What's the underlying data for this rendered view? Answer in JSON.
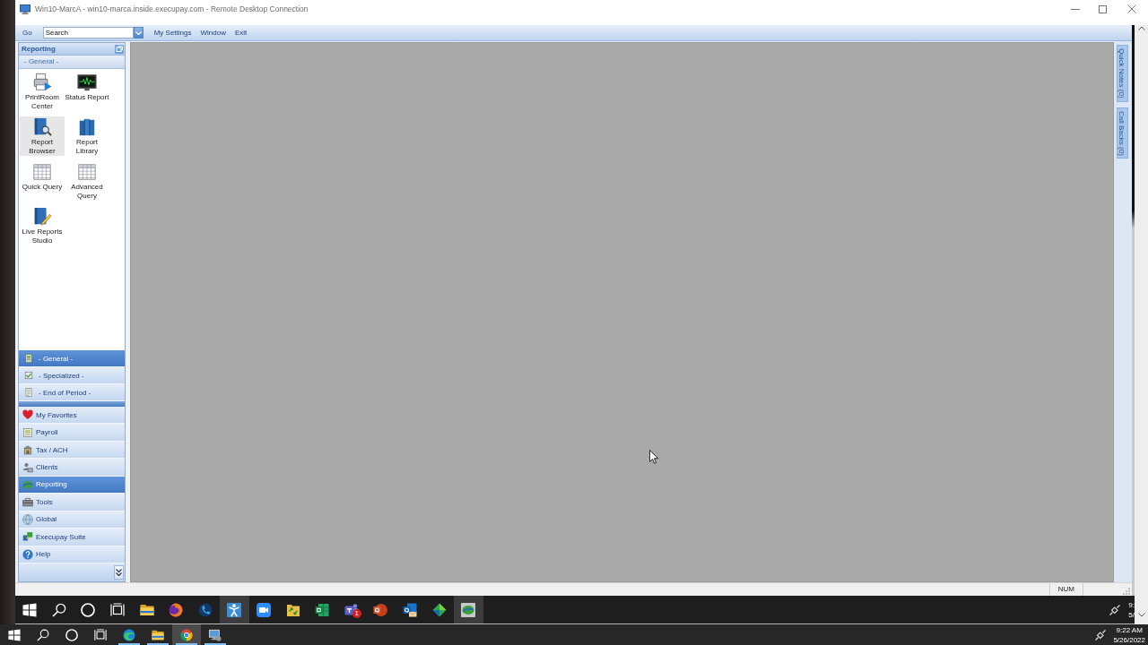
{
  "rdp_window": {
    "title": "Win10-MarcA - win10-marca.inside.execupay.com - Remote Desktop Connection"
  },
  "menu_bar": {
    "go": "Go",
    "search": {
      "value": "Search"
    },
    "menus": [
      {
        "label": "My Settings"
      },
      {
        "label": "Window"
      },
      {
        "label": "Exit"
      }
    ]
  },
  "sidebar": {
    "title": "Reporting",
    "section": "- General -",
    "tiles": [
      {
        "label": "PrintRoom Center",
        "kind": "printer",
        "selected": false
      },
      {
        "label": "Status Report",
        "kind": "monitor",
        "selected": false
      },
      {
        "label": "Report Browser",
        "kind": "booksearch",
        "selected": true
      },
      {
        "label": "Report Library",
        "kind": "books",
        "selected": false
      },
      {
        "label": "Quick Query",
        "kind": "grid",
        "selected": false
      },
      {
        "label": "Advanced Query",
        "kind": "grid",
        "selected": false
      },
      {
        "label": "Live Reports Studio",
        "kind": "bookpencil",
        "selected": false
      }
    ],
    "groups": [
      {
        "label": "- General -",
        "kind": "ledger",
        "selected": true
      },
      {
        "label": "- Specialized -",
        "kind": "checksheet",
        "selected": false
      },
      {
        "label": "- End of Period -",
        "kind": "document",
        "selected": false
      }
    ],
    "nav": [
      {
        "label": "My Favorites",
        "kind": "heart",
        "selected": false
      },
      {
        "label": "Payroll",
        "kind": "payroll",
        "selected": false
      },
      {
        "label": "Tax / ACH",
        "kind": "building",
        "selected": false
      },
      {
        "label": "Clients",
        "kind": "clients",
        "selected": false
      },
      {
        "label": "Reporting",
        "kind": "disc",
        "selected": true
      },
      {
        "label": "Tools",
        "kind": "toolbox",
        "selected": false
      },
      {
        "label": "Global",
        "kind": "globe",
        "selected": false
      },
      {
        "label": "Execupay Suite",
        "kind": "puzzle",
        "selected": false
      },
      {
        "label": "Help",
        "kind": "help",
        "selected": false
      }
    ]
  },
  "side_tabs": [
    {
      "label": "Quick Notes (0)"
    },
    {
      "label": "Call Backs (0)"
    }
  ],
  "status_bar": {
    "indicator": "NUM"
  },
  "remote_taskbar": {
    "buttons": [
      {
        "kind": "start"
      },
      {
        "kind": "search"
      },
      {
        "kind": "ring"
      },
      {
        "kind": "taskview"
      }
    ],
    "apps": [
      {
        "kind": "folder",
        "selected": false
      },
      {
        "kind": "foxglobe",
        "selected": false
      },
      {
        "kind": "phone",
        "selected": false
      },
      {
        "kind": "person",
        "selected": true
      },
      {
        "kind": "camera",
        "selected": false
      },
      {
        "kind": "folderarrows",
        "selected": false
      },
      {
        "kind": "spreadsheet",
        "selected": false
      },
      {
        "kind": "chat",
        "selected": false,
        "badge": "1"
      },
      {
        "kind": "slides",
        "selected": false
      },
      {
        "kind": "mail",
        "selected": false
      },
      {
        "kind": "diamond",
        "selected": false
      },
      {
        "kind": "disctile",
        "selected": true
      }
    ],
    "clock": {
      "time": "9:",
      "date": "5/"
    }
  },
  "host_taskbar": {
    "buttons": [
      {
        "kind": "start"
      },
      {
        "kind": "search"
      },
      {
        "kind": "ring"
      },
      {
        "kind": "taskview"
      }
    ],
    "apps": [
      {
        "kind": "wave",
        "selected": false,
        "running": true
      },
      {
        "kind": "folder",
        "selected": false,
        "running": true
      },
      {
        "kind": "wheel",
        "selected": true,
        "running": true
      },
      {
        "kind": "screen",
        "selected": false,
        "running": true
      }
    ],
    "clock": {
      "time": "9:22 AM",
      "date": "5/26/2022"
    }
  }
}
